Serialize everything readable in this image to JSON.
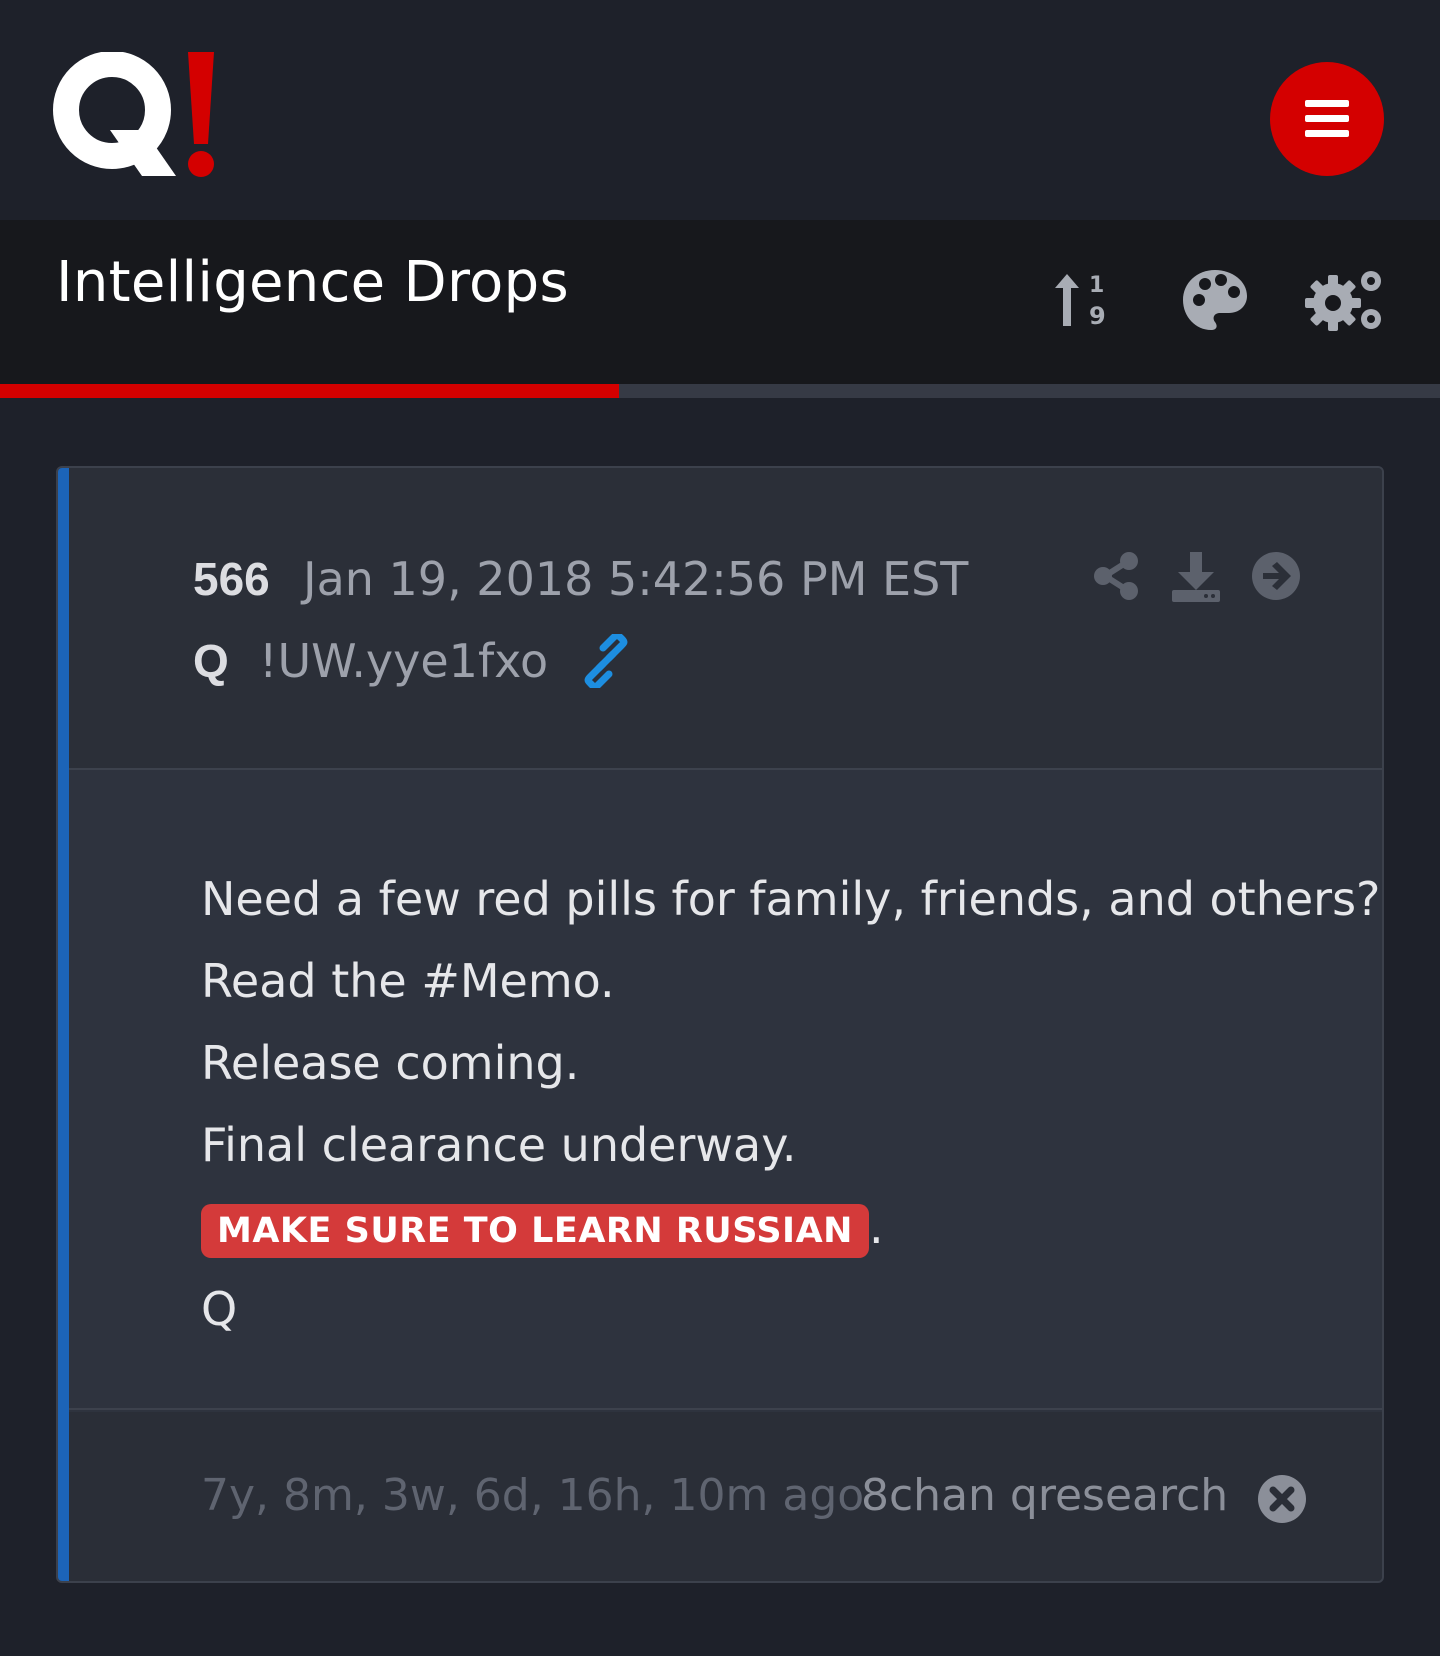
{
  "header": {
    "logo_letter": "Q",
    "logo_mark": "!",
    "menu_icon": "hamburger-menu-icon",
    "accent_color": "#d40000"
  },
  "titlebar": {
    "title": "Intelligence Drops",
    "actions": [
      "sort-numeric-icon",
      "palette-icon",
      "cogs-icon"
    ]
  },
  "progress": {
    "fraction": 0.43
  },
  "post": {
    "number": "566",
    "date": "Jan 19, 2018 5:42:56 PM EST",
    "author": "Q",
    "tripcode": "!UW.yye1fxo",
    "header_actions": [
      "share-icon",
      "download-icon",
      "arrow-right-circle-icon"
    ],
    "link_icon": "link-icon",
    "lines": [
      "Need a few red pills for family, friends, and others?",
      "Read the #Memo.",
      "Release coming.",
      "Final clearance underway."
    ],
    "highlight": "MAKE SURE TO LEARN RUSSIAN",
    "highlight_suffix": ".",
    "signature": "Q",
    "footer": {
      "ago": "7y, 8m, 3w, 6d, 16h, 10m ago",
      "source": "8chan qresearch",
      "close_icon": "close-circle-icon"
    },
    "accent_color": "#1c64b8",
    "highlight_color": "#d43a3a"
  }
}
